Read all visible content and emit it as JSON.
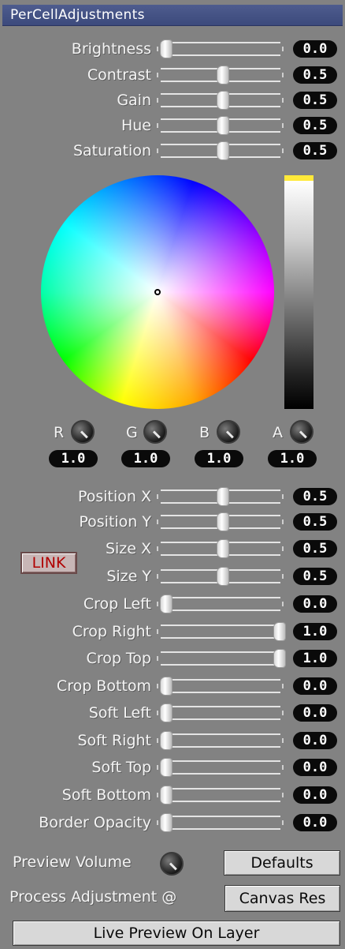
{
  "window": {
    "title": "PerCellAdjustments"
  },
  "color_sliders": [
    {
      "label": "Brightness",
      "value": "0.0",
      "level": 0.0
    },
    {
      "label": "Contrast",
      "value": "0.5",
      "level": 0.5
    },
    {
      "label": "Gain",
      "value": "0.5",
      "level": 0.5
    },
    {
      "label": "Hue",
      "value": "0.5",
      "level": 0.5
    },
    {
      "label": "Saturation",
      "value": "0.5",
      "level": 0.5
    }
  ],
  "channels": [
    {
      "label": "R",
      "value": "1.0"
    },
    {
      "label": "G",
      "value": "1.0"
    },
    {
      "label": "B",
      "value": "1.0"
    },
    {
      "label": "A",
      "value": "1.0"
    }
  ],
  "geometry_sliders": [
    {
      "label": "Position X",
      "value": "0.5",
      "level": 0.5
    },
    {
      "label": "Position Y",
      "value": "0.5",
      "level": 0.5
    },
    {
      "label": "Size X",
      "value": "0.5",
      "level": 0.5
    },
    {
      "label": "Size Y",
      "value": "0.5",
      "level": 0.5
    },
    {
      "label": "Crop Left",
      "value": "0.0",
      "level": 0.0
    },
    {
      "label": "Crop Right",
      "value": "1.0",
      "level": 1.0
    },
    {
      "label": "Crop Top",
      "value": "1.0",
      "level": 1.0
    },
    {
      "label": "Crop Bottom",
      "value": "0.0",
      "level": 0.0
    },
    {
      "label": "Soft Left",
      "value": "0.0",
      "level": 0.0
    },
    {
      "label": "Soft Right",
      "value": "0.0",
      "level": 0.0
    },
    {
      "label": "Soft Top",
      "value": "0.0",
      "level": 0.0
    },
    {
      "label": "Soft Bottom",
      "value": "0.0",
      "level": 0.0
    },
    {
      "label": "Border Opacity",
      "value": "0.0",
      "level": 0.0
    }
  ],
  "link_button": "LINK",
  "footer": {
    "preview_volume_label": "Preview Volume",
    "defaults_button": "Defaults",
    "process_label": "Process Adjustment @",
    "process_button": "Canvas Res",
    "live_preview_button": "Live Preview On Layer"
  },
  "colors": {
    "panel_bg": "#828282",
    "title_bg": "#4a578a",
    "value_pill": "#0a0a0a",
    "link_text": "#b00000",
    "brightness_cap": "#ffe93a"
  }
}
